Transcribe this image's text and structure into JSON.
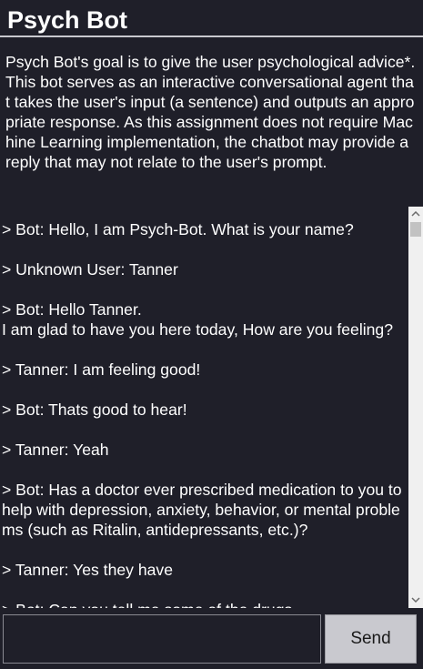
{
  "app": {
    "title": "Psych Bot"
  },
  "description": {
    "paragraphs": [
      "Psych Bot's goal is to give the user psychological advice*.",
      "This bot serves as an interactive conversational agent that takes the user's input (a sentence) and outputs an appropriate response. As this assignment does not require Machine Learning implementation, the chatbot may provide a reply that may not relate to the user's prompt."
    ]
  },
  "chat": {
    "messages": [
      "> Bot: Hello, I am Psych-Bot. What is your name?",
      "> Unknown User: Tanner",
      "> Bot: Hello Tanner.\nI am glad to have you here today, How are you feeling?",
      "> Tanner: I am feeling good!",
      "> Bot: Thats good to hear!",
      "> Tanner: Yeah",
      "> Bot: Has a doctor ever prescribed medication to you to help with depression, anxiety, behavior, or mental problems (such as Ritalin, antidepressants, etc.)?",
      "> Tanner: Yes they have",
      "> Bot: Can you tell me some of the drugs"
    ]
  },
  "input": {
    "value": "",
    "placeholder": ""
  },
  "send_button": {
    "label": "Send"
  },
  "scrollbar": {
    "up_icon": "arrow-up-icon",
    "down_icon": "arrow-down-icon"
  },
  "colors": {
    "background": "#1f1f29",
    "text": "#ffffff",
    "button": "#c9c9cf"
  }
}
